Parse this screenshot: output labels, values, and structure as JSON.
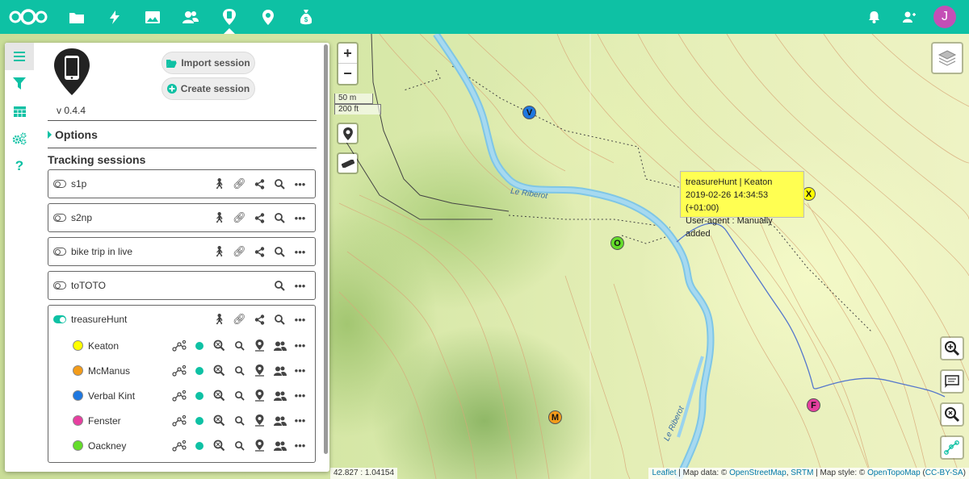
{
  "topbar": {
    "apps": [
      {
        "icon": "nextcloud-logo-icon"
      },
      {
        "icon": "files-folder-icon"
      },
      {
        "icon": "activity-lightning-icon"
      },
      {
        "icon": "gallery-image-icon"
      },
      {
        "icon": "contacts-people-icon"
      },
      {
        "icon": "phonetrack-phone-pin-icon"
      },
      {
        "icon": "maps-pin-icon"
      },
      {
        "icon": "money-bag-icon"
      }
    ],
    "right": {
      "notifications_icon": "bell-icon",
      "contacts_icon": "contacts-icon",
      "avatar_letter": "J",
      "avatar_color": "#c44fb6"
    },
    "accent": "#0ec1a4"
  },
  "sidebar": {
    "tabs": [
      "menu-icon",
      "filter-icon",
      "table-icon",
      "settings-cogs-icon",
      "help-icon"
    ],
    "version": "v 0.4.4",
    "import_label": "Import session",
    "create_label": "Create session",
    "options_label": "Options",
    "tracking_title": "Tracking sessions",
    "sessions": [
      {
        "name": "s1p",
        "enabled": false
      },
      {
        "name": "s2np",
        "enabled": false
      },
      {
        "name": "bike trip in live",
        "enabled": false
      },
      {
        "name": "toTOTO",
        "enabled": false
      },
      {
        "name": "treasureHunt",
        "enabled": true,
        "devices": [
          {
            "name": "Keaton",
            "color": "#ffff00"
          },
          {
            "name": "McManus",
            "color": "#f39c1a"
          },
          {
            "name": "Verbal Kint",
            "color": "#1e78e0"
          },
          {
            "name": "Fenster",
            "color": "#e73fa0"
          },
          {
            "name": "Oackney",
            "color": "#64dd2a"
          }
        ]
      }
    ]
  },
  "map": {
    "zoom_in": "+",
    "zoom_out": "−",
    "scale_metric": "50 m",
    "scale_imperial": "200 ft",
    "markers": [
      {
        "letter": "V",
        "color": "#1e78e0"
      },
      {
        "letter": "O",
        "color": "#64dd2a"
      },
      {
        "letter": "X",
        "color": "#ffff00"
      },
      {
        "letter": "M",
        "color": "#f39c1a"
      },
      {
        "letter": "F",
        "color": "#e73fa0"
      }
    ],
    "river_label": "Le Riberot",
    "popup": {
      "title": "treasureHunt | Keaton",
      "date": "2019-02-26 14:34:53 (+01:00)",
      "agent": "User-agent : Manually added"
    },
    "coords": "42.827 : 1.04154",
    "attribution": {
      "leaflet": "Leaflet",
      "sep1": " | Map data: © ",
      "osm": "OpenStreetMap",
      "comma": ", ",
      "srtm": "SRTM",
      "sep2": " | Map style: © ",
      "otm": "OpenTopoMap",
      "open": " (",
      "license": "CC-BY-SA",
      "close": ")"
    }
  }
}
